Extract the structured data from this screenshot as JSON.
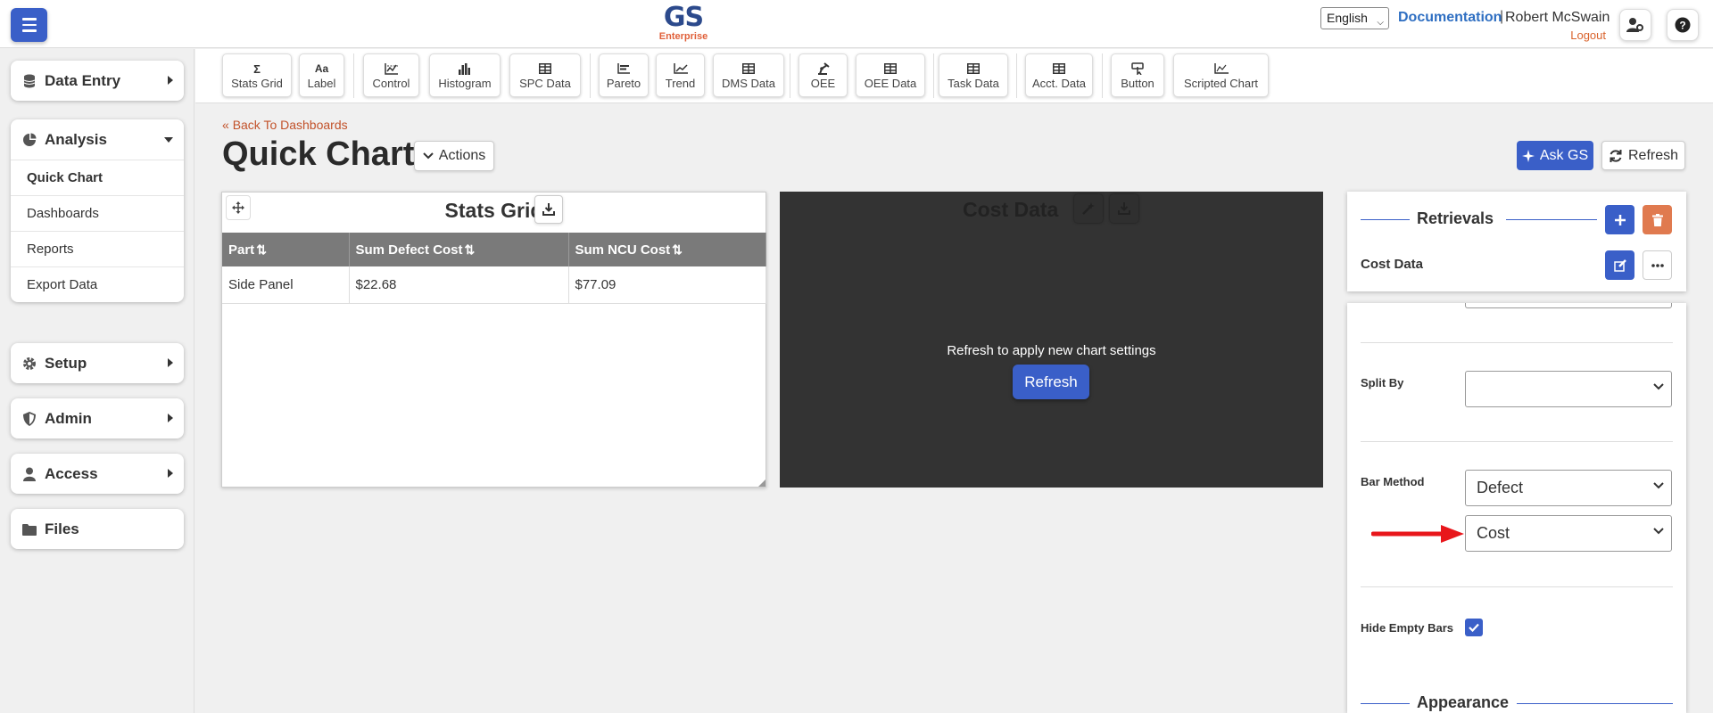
{
  "header": {
    "logo_main": "GS",
    "logo_sub": "Enterprise",
    "language": "English",
    "documentation": "Documentation",
    "separator": "|",
    "user": "Robert McSwain",
    "logout": "Logout",
    "icons": [
      "menu-icon",
      "user-settings-icon",
      "help-icon"
    ]
  },
  "sidebar": {
    "data_entry": "Data Entry",
    "analysis": "Analysis",
    "analysis_items": [
      "Quick Chart",
      "Dashboards",
      "Reports",
      "Export Data"
    ],
    "setup": "Setup",
    "admin": "Admin",
    "access": "Access",
    "files": "Files"
  },
  "toolbar": {
    "items": [
      {
        "icon": "Σ",
        "label": "Stats Grid"
      },
      {
        "icon": "Aa",
        "label": "Label"
      },
      {
        "icon": "control-chart-icon",
        "label": "Control"
      },
      {
        "icon": "histogram-icon",
        "label": "Histogram"
      },
      {
        "icon": "table-icon",
        "label": "SPC Data"
      },
      {
        "icon": "pareto-icon",
        "label": "Pareto"
      },
      {
        "icon": "trend-icon",
        "label": "Trend"
      },
      {
        "icon": "table-icon",
        "label": "DMS Data"
      },
      {
        "icon": "oee-icon",
        "label": "OEE"
      },
      {
        "icon": "table-icon",
        "label": "OEE Data"
      },
      {
        "icon": "table-icon",
        "label": "Task Data"
      },
      {
        "icon": "table-icon",
        "label": "Acct. Data"
      },
      {
        "icon": "button-icon",
        "label": "Button"
      },
      {
        "icon": "scripted-chart-icon",
        "label": "Scripted Chart"
      }
    ]
  },
  "main": {
    "back_link": "Back To Dashboards",
    "title": "Quick Chart",
    "actions": "Actions",
    "ask_gs": "Ask GS",
    "refresh": "Refresh"
  },
  "stats_grid": {
    "title": "Stats Grid",
    "columns": [
      "Part",
      "Sum Defect Cost",
      "Sum NCU Cost"
    ],
    "rows": [
      [
        "Side Panel",
        "$22.68",
        "$77.09"
      ]
    ]
  },
  "cost_data": {
    "title": "Cost Data",
    "message": "Refresh to apply new chart settings",
    "refresh": "Refresh",
    "background": "#333333"
  },
  "retrievals": {
    "title": "Retrievals",
    "item": "Cost Data"
  },
  "settings": {
    "split_by_label": "Split By",
    "split_by_value": "",
    "bar_method_label": "Bar Method",
    "bar_method_1": "Defect",
    "bar_method_2": "Cost",
    "hide_empty_label": "Hide Empty Bars",
    "hide_empty_checked": true,
    "appearance": "Appearance"
  },
  "colors": {
    "primary": "#3a5fc8",
    "accent": "#e07a4f",
    "link": "#2f6fc2",
    "annotation_arrow": "#e8161b"
  }
}
